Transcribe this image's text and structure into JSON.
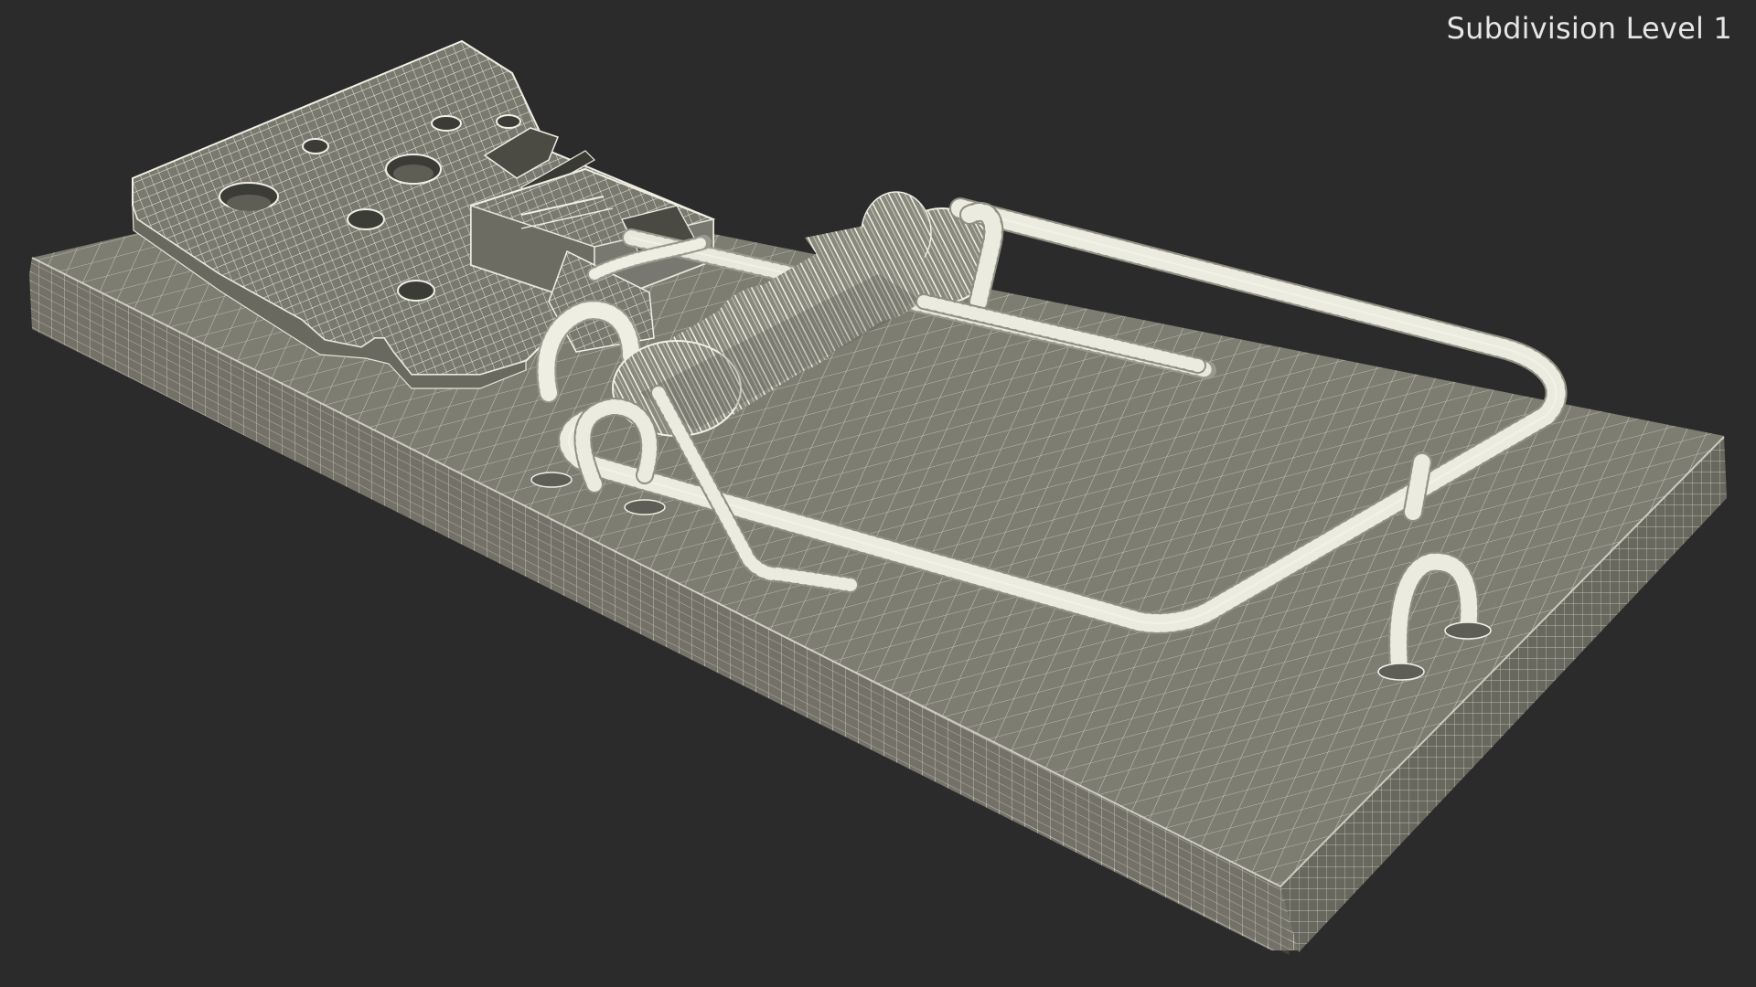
{
  "viewport": {
    "label": "Subdivision Level 1"
  },
  "scene": {
    "object": "wireframe mousetrap model",
    "colors": {
      "background": "#2b2b2b",
      "surface": "#7e7d72",
      "surface_dark": "#67665c",
      "surface_side": "#74736a",
      "wire": "#ecebe0"
    }
  }
}
